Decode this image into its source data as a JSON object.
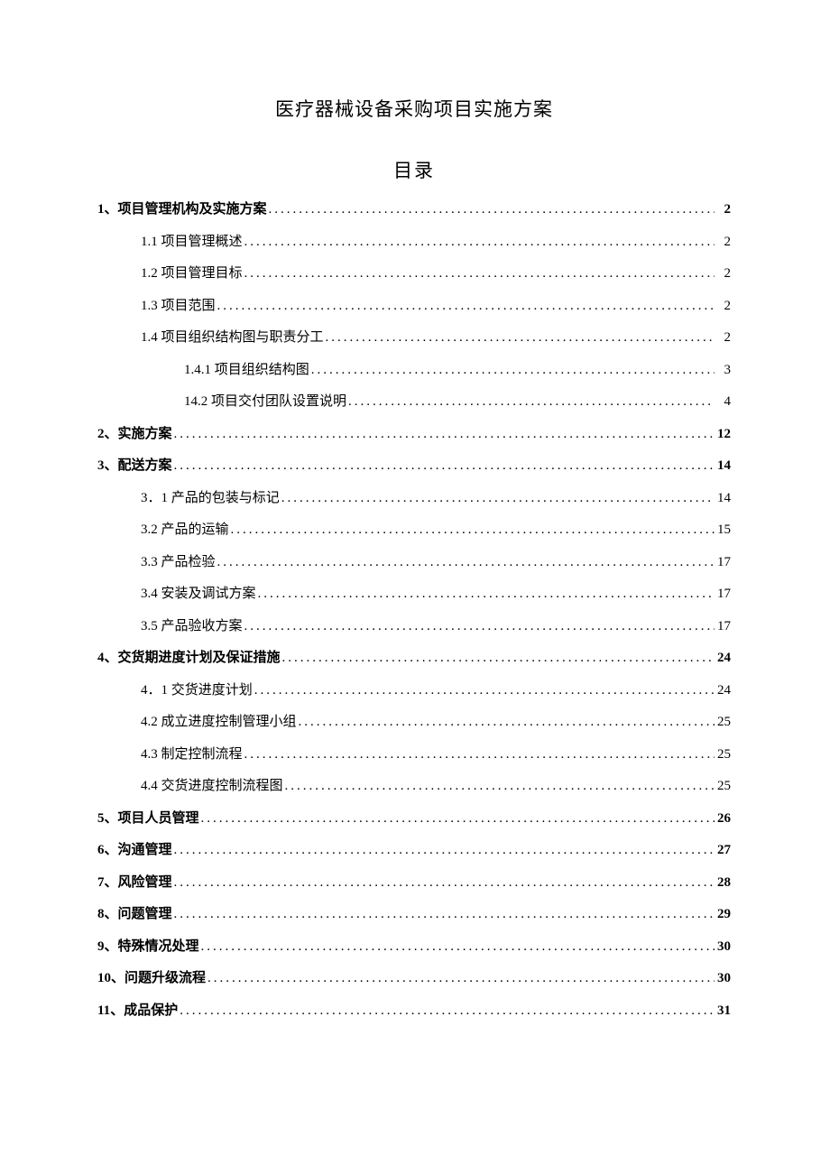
{
  "title": "医疗器械设备采购项目实施方案",
  "toc_heading": "目录",
  "entries": [
    {
      "label": "1、项目管理机构及实施方案",
      "page": "2",
      "level": 0,
      "bold": true
    },
    {
      "label": "1.1  项目管理概述",
      "page": "2",
      "level": 1,
      "bold": false
    },
    {
      "label": "1.2  项目管理目标",
      "page": "2",
      "level": 1,
      "bold": false
    },
    {
      "label": "1.3  项目范围",
      "page": "2",
      "level": 1,
      "bold": false
    },
    {
      "label": "1.4  项目组织结构图与职责分工",
      "page": "2",
      "level": 1,
      "bold": false
    },
    {
      "label": "1.4.1   项目组织结构图",
      "page": "3",
      "level": 2,
      "bold": false
    },
    {
      "label": "14.2 项目交付团队设置说明",
      "page": "4",
      "level": 2,
      "bold": false
    },
    {
      "label": "2、实施方案",
      "page": "12",
      "level": 0,
      "bold": true
    },
    {
      "label": "3、配送方案",
      "page": "14",
      "level": 0,
      "bold": true
    },
    {
      "label": "3．1 产品的包装与标记 ",
      "page": "14",
      "level": 1,
      "bold": false
    },
    {
      "label": "3.2   产品的运输 ",
      "page": "15",
      "level": 1,
      "bold": false
    },
    {
      "label": "3.3   产品检验 ",
      "page": "17",
      "level": 1,
      "bold": false
    },
    {
      "label": "3.4   安装及调试方案 ",
      "page": "17",
      "level": 1,
      "bold": false
    },
    {
      "label": "3.5   产品验收方案 ",
      "page": "17",
      "level": 1,
      "bold": false
    },
    {
      "label": "4、交货期进度计划及保证措施",
      "page": "24",
      "level": 0,
      "bold": true
    },
    {
      "label": "4．1 交货进度计划 ",
      "page": "24",
      "level": 1,
      "bold": false
    },
    {
      "label": "4.2   成立进度控制管理小组 ",
      "page": "25",
      "level": 1,
      "bold": false
    },
    {
      "label": "4.3   制定控制流程 ",
      "page": "25",
      "level": 1,
      "bold": false
    },
    {
      "label": "4.4   交货进度控制流程图 ",
      "page": "25",
      "level": 1,
      "bold": false
    },
    {
      "label": "5、项目人员管理",
      "page": "26",
      "level": 0,
      "bold": true
    },
    {
      "label": "6、沟通管理",
      "page": "27",
      "level": 0,
      "bold": true
    },
    {
      "label": "7、风险管理",
      "page": "28",
      "level": 0,
      "bold": true
    },
    {
      "label": "8、问题管理",
      "page": "29",
      "level": 0,
      "bold": true
    },
    {
      "label": "9、特殊情况处理",
      "page": "30",
      "level": 0,
      "bold": true
    },
    {
      "label": "10、问题升级流程",
      "page": "30",
      "level": 0,
      "bold": true
    },
    {
      "label": "11、成品保护",
      "page": "31",
      "level": 0,
      "bold": true
    }
  ]
}
